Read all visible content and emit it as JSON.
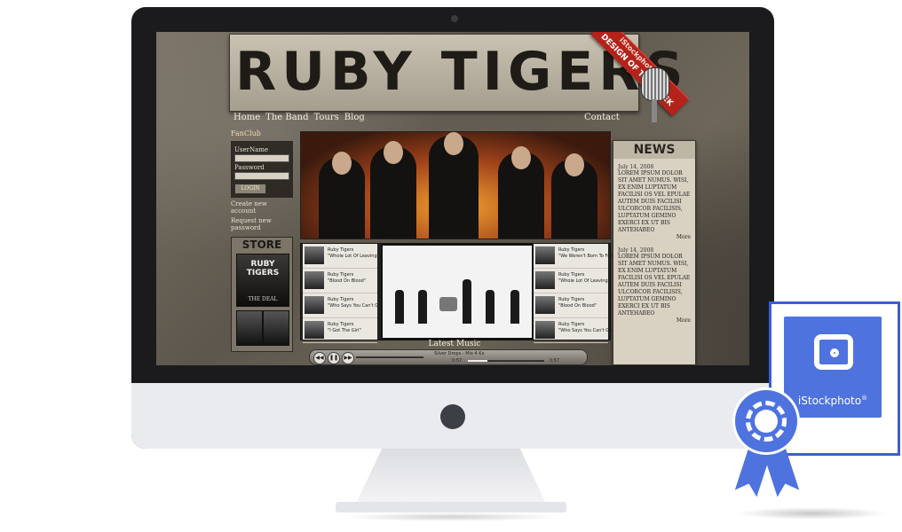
{
  "site": {
    "title": "RUBY TIGERS",
    "ribbon_top": "iStockphoto.com",
    "ribbon_main": "DESIGN OF THE WEEK"
  },
  "nav": {
    "items": [
      "Home",
      "The Band",
      "Tours",
      "Blog"
    ],
    "contact": "Contact",
    "fanclub": "FanClub"
  },
  "login": {
    "username_label": "UserName",
    "password_label": "Password",
    "button": "LOGIN",
    "create_account": "Create new account",
    "request_password": "Request new password"
  },
  "store": {
    "title": "STORE",
    "album_band": "RUBY TIGERS",
    "album_title": "THE DEAL"
  },
  "playlist": {
    "left": [
      {
        "artist": "Ruby Tigers",
        "title": "\"Whole Lot Of Leaving\""
      },
      {
        "artist": "Ruby Tigers",
        "title": "\"Blood On Blood\""
      },
      {
        "artist": "Ruby Tigers",
        "title": "\"Who Says You Can't Go Home\""
      },
      {
        "artist": "Ruby Tigers",
        "title": "\"I Got The Girl\""
      }
    ],
    "right": [
      {
        "artist": "Ruby Tigers",
        "title": "\"We Weren't Born To Follow\""
      },
      {
        "artist": "Ruby Tigers",
        "title": "\"Whole Lot Of Leaving\""
      },
      {
        "artist": "Ruby Tigers",
        "title": "\"Blood On Blood\""
      },
      {
        "artist": "Ruby Tigers",
        "title": "\"Who Says You Can't Go Home\""
      }
    ]
  },
  "latest_music": "Latest Music",
  "player": {
    "track": "Silver Drops - Mix 4 Kx",
    "time_elapsed": "0:57",
    "time_remaining": "-3:57",
    "progress": 0.25
  },
  "news": {
    "title": "NEWS",
    "items": [
      {
        "date": "July 14, 2008",
        "body": "Lorem ipsum dolor sit amet numus. Wisi, ex enim luptatum facilisi os vel epulae autem duis facilisi ulcorcor facilisis, luptatum gemino exerci ex ut bis antehabeo",
        "more": "More"
      },
      {
        "date": "July 14, 2008",
        "body": "Lorem ipsum dolor sit amet numus. Wisi, ex enim luptatum facilisi os vel epulae autem duis facilisi ulcorcor facilisis, luptatum gemino exerci ex ut bis antehabeo",
        "more": "More"
      }
    ]
  },
  "badge": {
    "brand": "iStockphoto",
    "trademark": "®",
    "accent_color": "#4e73df"
  },
  "icons": [
    "camera-icon",
    "microphone-icon",
    "rosette-icon",
    "play-icon",
    "pause-icon",
    "rewind-icon",
    "forward-icon"
  ]
}
